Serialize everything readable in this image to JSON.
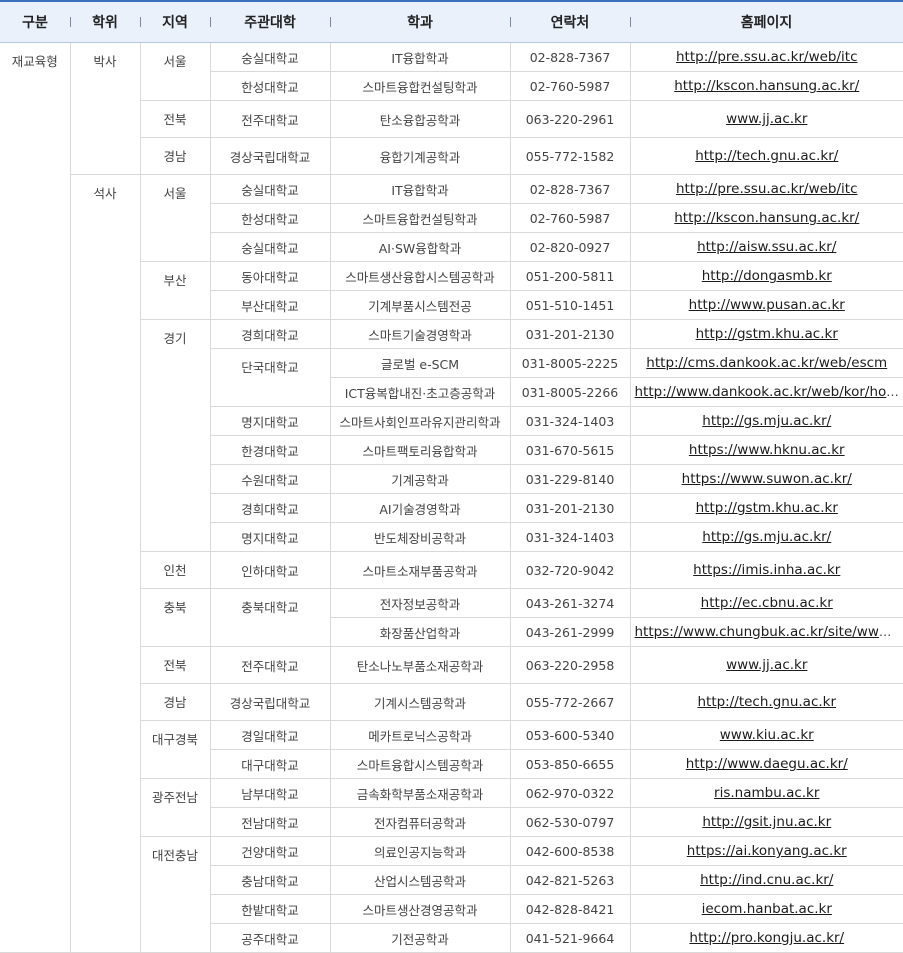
{
  "header": {
    "c0": "구분",
    "c1": "학위",
    "c2": "지역",
    "c3": "주관대학",
    "c4": "학과",
    "c5": "연락처",
    "c6": "홈페이지"
  },
  "category": "재교육형",
  "degrees": [
    "박사",
    "석사"
  ],
  "regions": {
    "seoul": "서울",
    "jeonbuk": "전북",
    "gyeongnam": "경남",
    "busan": "부산",
    "gyeonggi": "경기",
    "incheon": "인천",
    "chungbuk": "충북",
    "daegu": "대구경북",
    "gwangju": "광주전남",
    "daejeon": "대전충남"
  },
  "rows": [
    {
      "univ": "숭실대학교",
      "dept": "IT융합학과",
      "phone": "02-828-7367",
      "url": "http://pre.ssu.ac.kr/web/itc"
    },
    {
      "univ": "한성대학교",
      "dept": "스마트융합컨설팅학과",
      "phone": "02-760-5987",
      "url": "http://kscon.hansung.ac.kr/"
    },
    {
      "univ": "전주대학교",
      "dept": "탄소융합공학과",
      "phone": "063-220-2961",
      "url": "www.jj.ac.kr"
    },
    {
      "univ": "경상국립대학교",
      "dept": "융합기계공학과",
      "phone": "055-772-1582",
      "url": "http://tech.gnu.ac.kr/"
    },
    {
      "univ": "숭실대학교",
      "dept": "IT융합학과",
      "phone": "02-828-7367",
      "url": "http://pre.ssu.ac.kr/web/itc"
    },
    {
      "univ": "한성대학교",
      "dept": "스마트융합컨설팅학과",
      "phone": "02-760-5987",
      "url": "http://kscon.hansung.ac.kr/"
    },
    {
      "univ": "숭실대학교",
      "dept": "AI·SW융합학과",
      "phone": "02-820-0927",
      "url": "http://aisw.ssu.ac.kr/"
    },
    {
      "univ": "동아대학교",
      "dept": "스마트생산융합시스템공학과",
      "phone": "051-200-5811",
      "url": "http://dongasmb.kr"
    },
    {
      "univ": "부산대학교",
      "dept": "기계부품시스템전공",
      "phone": "051-510-1451",
      "url": "http://www.pusan.ac.kr"
    },
    {
      "univ": "경희대학교",
      "dept": "스마트기술경영학과",
      "phone": "031-201-2130",
      "url": "http://gstm.khu.ac.kr"
    },
    {
      "univ": "단국대학교",
      "dept": "글로벌 e-SCM",
      "phone": "031-8005-2225",
      "url": "http://cms.dankook.ac.kr/web/escm"
    },
    {
      "univ": "",
      "dept": "ICT융복합내진·초고층공학과",
      "phone": "031-8005-2266",
      "url": "http://www.dankook.ac.kr/web/kor/hom…"
    },
    {
      "univ": "명지대학교",
      "dept": "스마트사회인프라유지관리학과",
      "phone": "031-324-1403",
      "url": "http://gs.mju.ac.kr/"
    },
    {
      "univ": "한경대학교",
      "dept": "스마트팩토리융합학과",
      "phone": "031-670-5615",
      "url": "https://www.hknu.ac.kr"
    },
    {
      "univ": "수원대학교",
      "dept": "기계공학과",
      "phone": "031-229-8140",
      "url": "https://www.suwon.ac.kr/"
    },
    {
      "univ": "경희대학교",
      "dept": "AI기술경영학과",
      "phone": "031-201-2130",
      "url": "http://gstm.khu.ac.kr"
    },
    {
      "univ": "명지대학교",
      "dept": "반도체장비공학과",
      "phone": "031-324-1403",
      "url": "http://gs.mju.ac.kr/"
    },
    {
      "univ": "인하대학교",
      "dept": "스마트소재부품공학과",
      "phone": "032-720-9042",
      "url": "https://imis.inha.ac.kr"
    },
    {
      "univ": "충북대학교",
      "dept": "전자정보공학과",
      "phone": "043-261-3274",
      "url": "http://ec.cbnu.ac.kr"
    },
    {
      "univ": "",
      "dept": "화장품산업학과",
      "phone": "043-261-2999",
      "url": "https://www.chungbuk.ac.kr/site/www/…"
    },
    {
      "univ": "전주대학교",
      "dept": "탄소나노부품소재공학과",
      "phone": "063-220-2958",
      "url": "www.jj.ac.kr"
    },
    {
      "univ": "경상국립대학교",
      "dept": "기계시스템공학과",
      "phone": "055-772-2667",
      "url": "http://tech.gnu.ac.kr"
    },
    {
      "univ": "경일대학교",
      "dept": "메카트로닉스공학과",
      "phone": "053-600-5340",
      "url": "www.kiu.ac.kr"
    },
    {
      "univ": "대구대학교",
      "dept": "스마트융합시스템공학과",
      "phone": "053-850-6655",
      "url": "http://www.daegu.ac.kr/"
    },
    {
      "univ": "남부대학교",
      "dept": "금속화학부품소재공학과",
      "phone": "062-970-0322",
      "url": "ris.nambu.ac.kr"
    },
    {
      "univ": "전남대학교",
      "dept": "전자컴퓨터공학과",
      "phone": "062-530-0797",
      "url": "http://gsit.jnu.ac.kr"
    },
    {
      "univ": "건양대학교",
      "dept": "의료인공지능학과",
      "phone": "042-600-8538",
      "url": "https://ai.konyang.ac.kr"
    },
    {
      "univ": "충남대학교",
      "dept": "산업시스템공학과",
      "phone": "042-821-5263",
      "url": "http://ind.cnu.ac.kr/"
    },
    {
      "univ": "한밭대학교",
      "dept": "스마트생산경영공학과",
      "phone": "042-828-8421",
      "url": "iecom.hanbat.ac.kr"
    },
    {
      "univ": "공주대학교",
      "dept": "기전공학과",
      "phone": "041-521-9664",
      "url": "http://pro.kongju.ac.kr/"
    }
  ]
}
